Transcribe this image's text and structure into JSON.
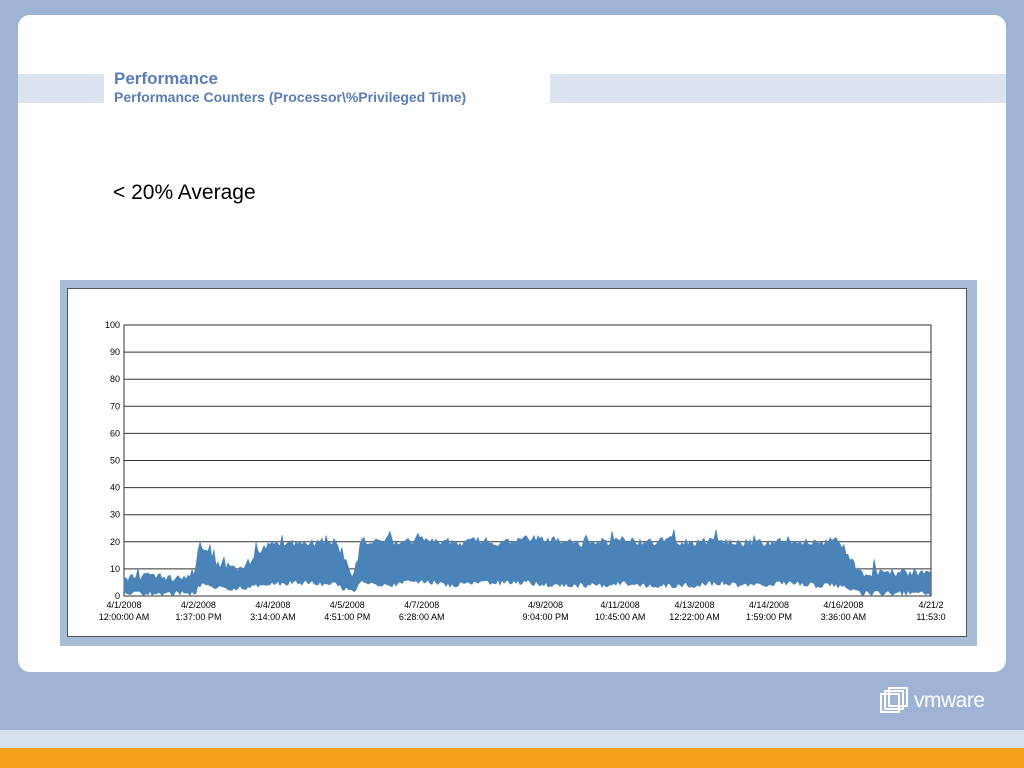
{
  "slide": {
    "title": "Performance",
    "subtitle": "Performance Counters (Processor\\%Privileged Time)",
    "body_text": "< 20% Average"
  },
  "brand": {
    "logo_text": "vmware",
    "logo_icon": "vmware-logo-icon"
  },
  "colors": {
    "background": "#9fb4d5",
    "title": "#5b7db6",
    "series": "#4a83b8",
    "accent_orange": "#f4a11b"
  },
  "chart_data": {
    "type": "area",
    "title": "",
    "xlabel": "",
    "ylabel": "",
    "ylim": [
      0,
      100
    ],
    "yticks": [
      0,
      10,
      20,
      30,
      40,
      50,
      60,
      70,
      80,
      90,
      100
    ],
    "grid": true,
    "xlim": [
      "2008-04-01T00:00",
      "2008-04-17T23:53"
    ],
    "xtick_labels": [
      {
        "x": "2008-04-01T00:00",
        "date": "4/1/2008",
        "time": "12:00:00 AM"
      },
      {
        "x": "2008-04-02T13:37",
        "date": "4/2/2008",
        "time": "1:37:00 PM"
      },
      {
        "x": "2008-04-04T03:14",
        "date": "4/4/2008",
        "time": "3:14:00 AM"
      },
      {
        "x": "2008-04-05T16:51",
        "date": "4/5/2008",
        "time": "4:51:00 PM"
      },
      {
        "x": "2008-04-07T06:28",
        "date": "4/7/2008",
        "time": "6:28:00 AM"
      },
      {
        "x": "2008-04-09T21:04",
        "date": "4/9/2008",
        "time": "9:04:00 PM"
      },
      {
        "x": "2008-04-11T10:45",
        "date": "4/11/2008",
        "time": "10:45:00 AM"
      },
      {
        "x": "2008-04-13T00:22",
        "date": "4/13/2008",
        "time": "12:22:00 AM"
      },
      {
        "x": "2008-04-14T13:59",
        "date": "4/14/2008",
        "time": "1:59:00 PM"
      },
      {
        "x": "2008-04-16T03:36",
        "date": "4/16/2008",
        "time": "3:36:00 AM"
      },
      {
        "x": "2008-04-17T23:53",
        "date": "4/21/2",
        "time": "11:53:0"
      }
    ],
    "series": [
      {
        "values_x": [
          "2008-04-01T00:00",
          "2008-04-01T12:00",
          "2008-04-02T00:00",
          "2008-04-02T12:00",
          "2008-04-02T14:00",
          "2008-04-03T00:00",
          "2008-04-03T12:00",
          "2008-04-04T00:00",
          "2008-04-04T12:00",
          "2008-04-05T00:00",
          "2008-04-05T12:00",
          "2008-04-05T20:00",
          "2008-04-06T00:00",
          "2008-04-06T12:00",
          "2008-04-07T00:00",
          "2008-04-07T12:00",
          "2008-04-08T00:00",
          "2008-04-08T12:00",
          "2008-04-09T00:00",
          "2008-04-09T12:00",
          "2008-04-10T00:00",
          "2008-04-10T12:00",
          "2008-04-11T00:00",
          "2008-04-11T12:00",
          "2008-04-12T00:00",
          "2008-04-12T12:00",
          "2008-04-13T00:00",
          "2008-04-13T12:00",
          "2008-04-14T00:00",
          "2008-04-14T12:00",
          "2008-04-15T00:00",
          "2008-04-15T12:00",
          "2008-04-16T00:00",
          "2008-04-16T12:00",
          "2008-04-17T00:00",
          "2008-04-17T12:00",
          "2008-04-17T23:53"
        ],
        "high": [
          8,
          9,
          8,
          10,
          20,
          13,
          12,
          20,
          21,
          21,
          20,
          8,
          22,
          21,
          22,
          22,
          21,
          22,
          21,
          23,
          22,
          21,
          21,
          22,
          21,
          22,
          21,
          22,
          21,
          21,
          22,
          21,
          22,
          10,
          10,
          10,
          10
        ],
        "low": [
          2,
          2,
          2,
          2,
          5,
          4,
          4,
          5,
          6,
          6,
          5,
          2,
          6,
          5,
          6,
          6,
          5,
          6,
          6,
          6,
          5,
          5,
          5,
          6,
          5,
          5,
          5,
          6,
          5,
          5,
          6,
          5,
          5,
          2,
          2,
          2,
          2
        ],
        "color": "#4a83b8"
      }
    ]
  }
}
